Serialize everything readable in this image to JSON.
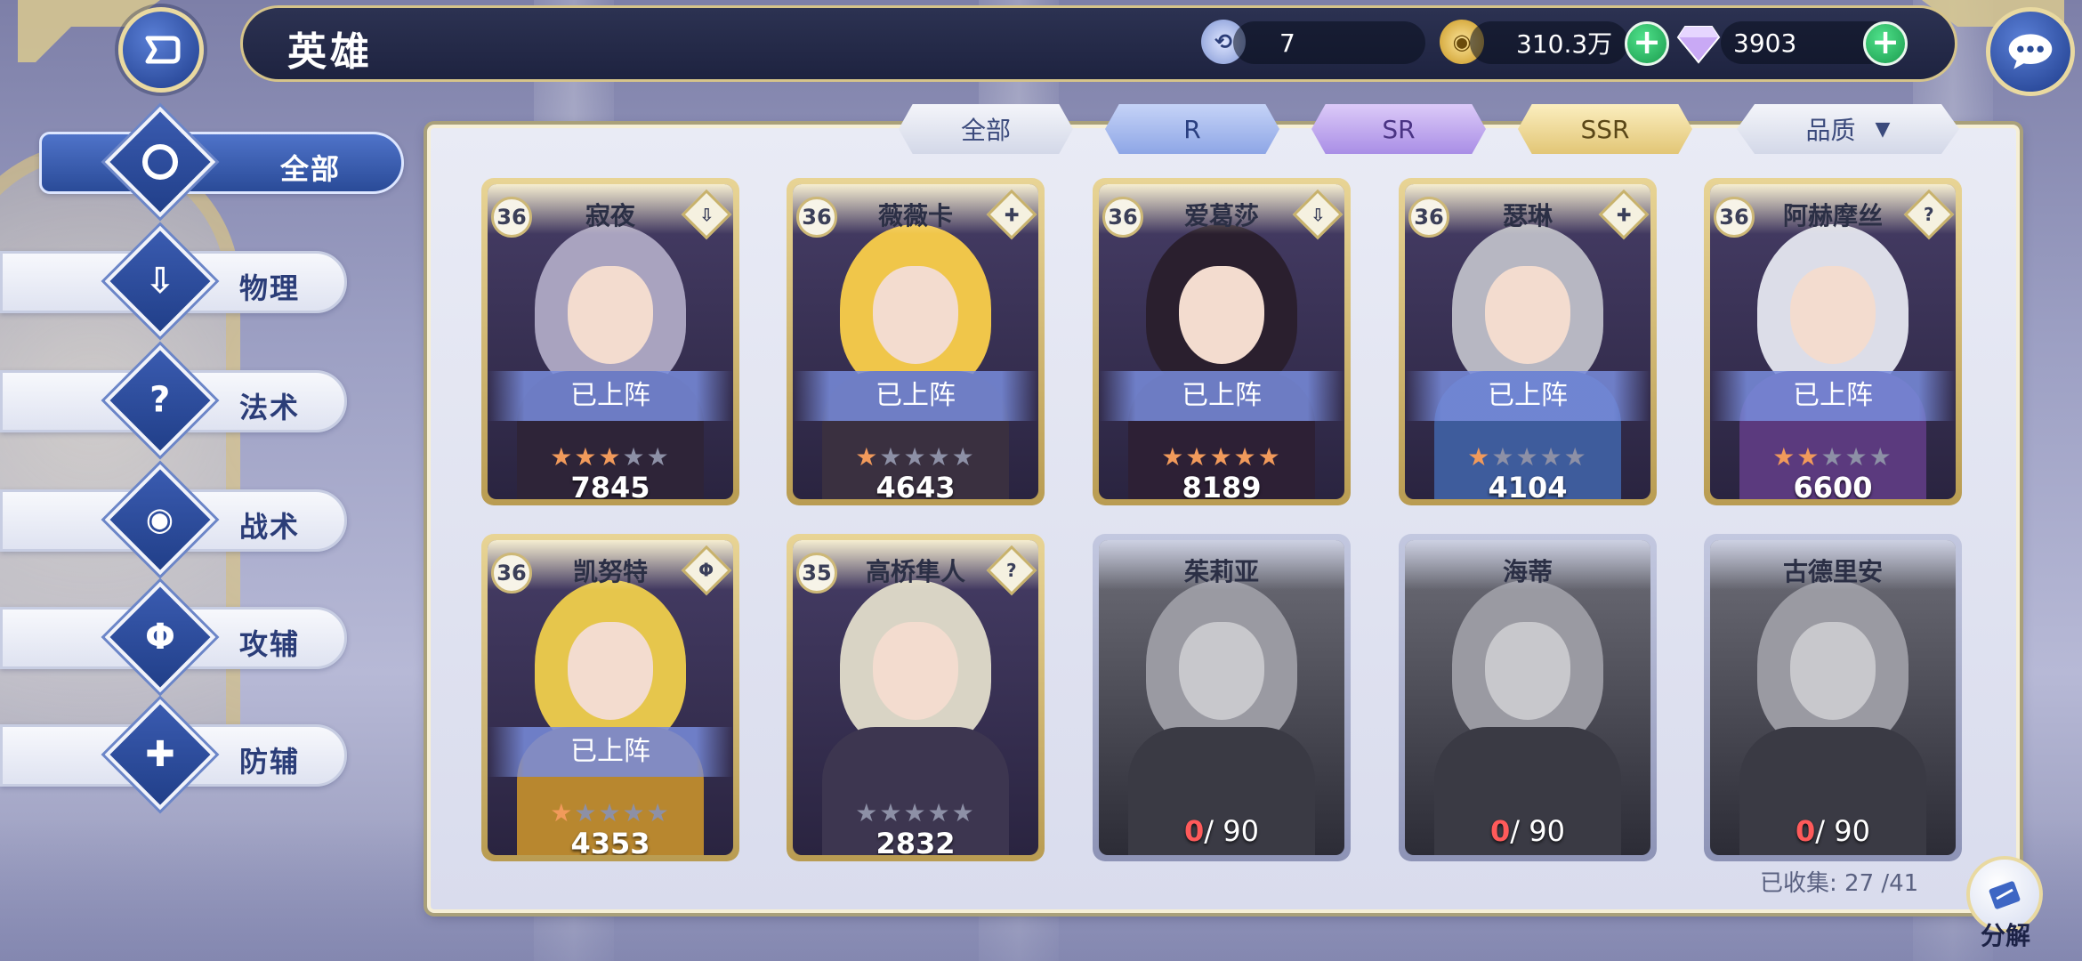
{
  "header": {
    "title": "英雄",
    "stamina_value": "7",
    "gold_value": "310.3万",
    "gem_value": "3903"
  },
  "sidebar": {
    "items": [
      {
        "label": "全部",
        "icon": "ring-icon",
        "active": true
      },
      {
        "label": "物理",
        "icon": "sword-icon"
      },
      {
        "label": "法术",
        "icon": "hook-staff-icon"
      },
      {
        "label": "战术",
        "icon": "eye-icon"
      },
      {
        "label": "攻辅",
        "icon": "winged-sword-icon"
      },
      {
        "label": "防辅",
        "icon": "shield-icon"
      }
    ]
  },
  "tabs": {
    "all": "全部",
    "r": "R",
    "sr": "SR",
    "ssr": "SSR",
    "quality": "品质",
    "selected": "SSR"
  },
  "heroes": [
    {
      "level": "36",
      "name": "寂夜",
      "class_glyph": "⇩",
      "deployed_label": "已上阵",
      "stars": 3,
      "power": "7845",
      "hair": "#a9a3bf",
      "body": "#2e2438"
    },
    {
      "level": "36",
      "name": "薇薇卡",
      "class_glyph": "✚",
      "deployed_label": "已上阵",
      "stars": 1,
      "power": "4643",
      "hair": "#f0c64a",
      "body": "#3a3040"
    },
    {
      "level": "36",
      "name": "爱葛莎",
      "class_glyph": "⇩",
      "deployed_label": "已上阵",
      "stars": 5,
      "power": "8189",
      "hair": "#2a1f2e",
      "body": "#2d2035"
    },
    {
      "level": "36",
      "name": "瑟琳",
      "class_glyph": "✚",
      "deployed_label": "已上阵",
      "stars": 1,
      "power": "4104",
      "hair": "#b7b7c2",
      "body": "#3e5c9c"
    },
    {
      "level": "36",
      "name": "阿赫摩丝",
      "class_glyph": "?",
      "deployed_label": "已上阵",
      "stars": 2,
      "power": "6600",
      "hair": "#dcdde8",
      "body": "#5b3a7e"
    },
    {
      "level": "36",
      "name": "凯努特",
      "class_glyph": "Φ",
      "deployed_label": "已上阵",
      "stars": 1,
      "power": "4353",
      "hair": "#e6c64c",
      "body": "#b8872f"
    },
    {
      "level": "35",
      "name": "高桥隼人",
      "class_glyph": "?",
      "stars": 0,
      "power": "2832",
      "hair": "#d9d4c5",
      "body": "#3d3650"
    }
  ],
  "locked_heroes": [
    {
      "name": "茱莉亚",
      "fragments_current": "0",
      "fragments_total": "/ 90"
    },
    {
      "name": "海蒂",
      "fragments_current": "0",
      "fragments_total": "/ 90"
    },
    {
      "name": "古德里安",
      "fragments_current": "0",
      "fragments_total": "/ 90"
    }
  ],
  "footer": {
    "collected": "已收集: 27 /41",
    "decompose_label": "分解"
  },
  "colors": {
    "accent_gold": "#d6c48a",
    "accent_blue": "#2a4b98",
    "star_active": "#f19a5b",
    "fragment_current": "#ff5a5a"
  }
}
